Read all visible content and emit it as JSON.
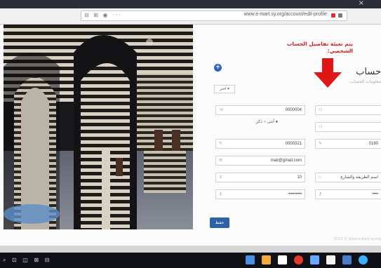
{
  "browser": {
    "url": "www.e-mart.sy.org/account/edit-profile",
    "nav_icons": "⊟ ⊞ ◉ ···",
    "tab_close": "×",
    "icons": [
      "lock-icon",
      "settings-icon",
      "close-icon"
    ]
  },
  "annotation": {
    "line1": "يتم تعبئة تفاصيل الحساب",
    "line2": "الشخصي:",
    "arrow_color": "#e01515"
  },
  "form": {
    "title": "حساب",
    "subtitle": "معلومات الحساب",
    "add_button": "+",
    "select_value": "اختر ▾",
    "rows": [
      {
        "right": "",
        "left": "0000004"
      },
      {
        "right": "",
        "left": ""
      },
      {
        "right": "0160",
        "left": "0000321"
      },
      {
        "right": "",
        "left": "mail@gmail.com"
      },
      {
        "right": "اسم الطريقة والشارع",
        "left": "10"
      },
      {
        "right": "••••",
        "left": "•••••••••"
      }
    ],
    "radio_female": "أنثى",
    "radio_male": "ذكر",
    "save_label": "حفظ",
    "footer": "2023 ©  www.e-mart.sy.org"
  },
  "taskbar": {
    "left_icons": "⌕ ⊡ ◫ ⊠ ⊟",
    "colors": [
      "#4a90e2",
      "#f2a93b",
      "#ffffff",
      "#e03b2b",
      "#66aaff",
      "#f3f3f3",
      "#4a7cc9",
      "#3ab0ff"
    ]
  },
  "colors": {
    "accent": "#2c63a8",
    "annotation": "#e01515",
    "plus": "#2c63c2"
  }
}
